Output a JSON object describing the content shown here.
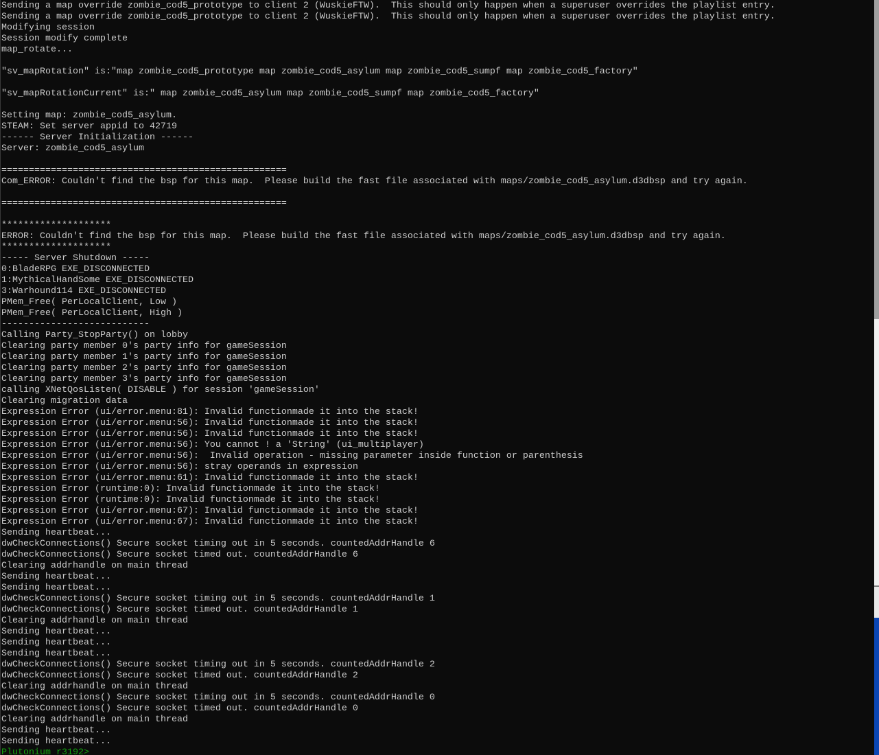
{
  "console": {
    "lines": [
      "Sending a map override zombie_cod5_prototype to client 2 (WuskieFTW).  This should only happen when a superuser overrides the playlist entry.",
      "Sending a map override zombie_cod5_prototype to client 2 (WuskieFTW).  This should only happen when a superuser overrides the playlist entry.",
      "Modifying session",
      "Session modify complete",
      "map_rotate...",
      "",
      "\"sv_mapRotation\" is:\"map zombie_cod5_prototype map zombie_cod5_asylum map zombie_cod5_sumpf map zombie_cod5_factory\"",
      "",
      "\"sv_mapRotationCurrent\" is:\" map zombie_cod5_asylum map zombie_cod5_sumpf map zombie_cod5_factory\"",
      "",
      "Setting map: zombie_cod5_asylum.",
      "STEAM: Set server appid to 42719",
      "------ Server Initialization ------",
      "Server: zombie_cod5_asylum",
      "",
      "====================================================",
      "Com_ERROR: Couldn't find the bsp for this map.  Please build the fast file associated with maps/zombie_cod5_asylum.d3dbsp and try again.",
      "",
      "====================================================",
      "",
      "********************",
      "ERROR: Couldn't find the bsp for this map.  Please build the fast file associated with maps/zombie_cod5_asylum.d3dbsp and try again.",
      "********************",
      "----- Server Shutdown -----",
      "0:BladeRPG EXE_DISCONNECTED",
      "1:MythicalHandSome EXE_DISCONNECTED",
      "3:Warhound114 EXE_DISCONNECTED",
      "PMem_Free( PerLocalClient, Low )",
      "PMem_Free( PerLocalClient, High )",
      "---------------------------",
      "Calling Party_StopParty() on lobby",
      "Clearing party member 0's party info for gameSession",
      "Clearing party member 1's party info for gameSession",
      "Clearing party member 2's party info for gameSession",
      "Clearing party member 3's party info for gameSession",
      "calling XNetQosListen( DISABLE ) for session 'gameSession'",
      "Clearing migration data",
      "Expression Error (ui/error.menu:81): Invalid functionmade it into the stack!",
      "Expression Error (ui/error.menu:56): Invalid functionmade it into the stack!",
      "Expression Error (ui/error.menu:56): Invalid functionmade it into the stack!",
      "Expression Error (ui/error.menu:56): You cannot ! a 'String' (ui_multiplayer)",
      "Expression Error (ui/error.menu:56):  Invalid operation - missing parameter inside function or parenthesis",
      "Expression Error (ui/error.menu:56): stray operands in expression",
      "Expression Error (ui/error.menu:61): Invalid functionmade it into the stack!",
      "Expression Error (runtime:0): Invalid functionmade it into the stack!",
      "Expression Error (runtime:0): Invalid functionmade it into the stack!",
      "Expression Error (ui/error.menu:67): Invalid functionmade it into the stack!",
      "Expression Error (ui/error.menu:67): Invalid functionmade it into the stack!",
      "Sending heartbeat...",
      "dwCheckConnections() Secure socket timing out in 5 seconds. countedAddrHandle 6",
      "dwCheckConnections() Secure socket timed out. countedAddrHandle 6",
      "Clearing addrhandle on main thread",
      "Sending heartbeat...",
      "Sending heartbeat...",
      "dwCheckConnections() Secure socket timing out in 5 seconds. countedAddrHandle 1",
      "dwCheckConnections() Secure socket timed out. countedAddrHandle 1",
      "Clearing addrhandle on main thread",
      "Sending heartbeat...",
      "Sending heartbeat...",
      "Sending heartbeat...",
      "dwCheckConnections() Secure socket timing out in 5 seconds. countedAddrHandle 2",
      "dwCheckConnections() Secure socket timed out. countedAddrHandle 2",
      "Clearing addrhandle on main thread",
      "dwCheckConnections() Secure socket timing out in 5 seconds. countedAddrHandle 0",
      "dwCheckConnections() Secure socket timed out. countedAddrHandle 0",
      "Clearing addrhandle on main thread",
      "Sending heartbeat...",
      "Sending heartbeat..."
    ],
    "prompt": "Plutonium r3192>"
  },
  "colors": {
    "background": "#0c0c0c",
    "text": "#cccccc",
    "prompt": "#13a10e"
  }
}
